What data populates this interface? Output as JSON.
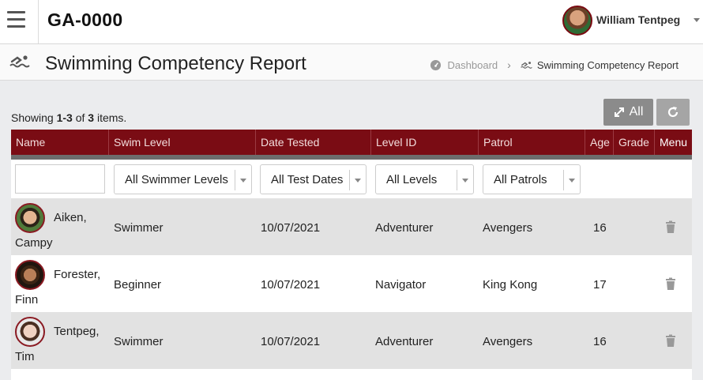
{
  "header": {
    "app_title": "GA-0000",
    "user_name": "William Tentpeg"
  },
  "page": {
    "title": "Swimming Competency Report",
    "breadcrumb": {
      "home": "Dashboard",
      "current": "Swimming Competency Report"
    }
  },
  "summary": {
    "prefix": "Showing ",
    "range": "1-3",
    "middle": " of ",
    "total": "3",
    "suffix": " items."
  },
  "toolbar": {
    "all_label": "All"
  },
  "table": {
    "columns": [
      "Name",
      "Swim Level",
      "Date Tested",
      "Level ID",
      "Patrol",
      "Age",
      "Grade",
      "Menu"
    ],
    "filters": {
      "name_value": "",
      "swim_level": "All Swimmer Levels",
      "date_tested": "All Test Dates",
      "level_id": "All Levels",
      "patrol": "All Patrols"
    },
    "rows": [
      {
        "name_line1": "Aiken,",
        "name_line2": "Campy",
        "swim_level": "Swimmer",
        "date_tested": "10/07/2021",
        "level_id": "Adventurer",
        "patrol": "Avengers",
        "age": "16",
        "grade": ""
      },
      {
        "name_line1": "Forester,",
        "name_line2": "Finn",
        "swim_level": "Beginner",
        "date_tested": "10/07/2021",
        "level_id": "Navigator",
        "patrol": "King Kong",
        "age": "17",
        "grade": ""
      },
      {
        "name_line1": "Tentpeg,",
        "name_line2": "Tim",
        "swim_level": "Swimmer",
        "date_tested": "10/07/2021",
        "level_id": "Adventurer",
        "patrol": "Avengers",
        "age": "16",
        "grade": ""
      }
    ]
  },
  "colors": {
    "header_bar": "#7a0c14",
    "alt_row": "#e2e2e2",
    "button": "#8b8b8b"
  },
  "icons": [
    "hamburger-icon",
    "swimmer-icon",
    "dashboard-icon",
    "expand-icon",
    "refresh-icon",
    "trash-icon",
    "chevron-down-icon"
  ]
}
